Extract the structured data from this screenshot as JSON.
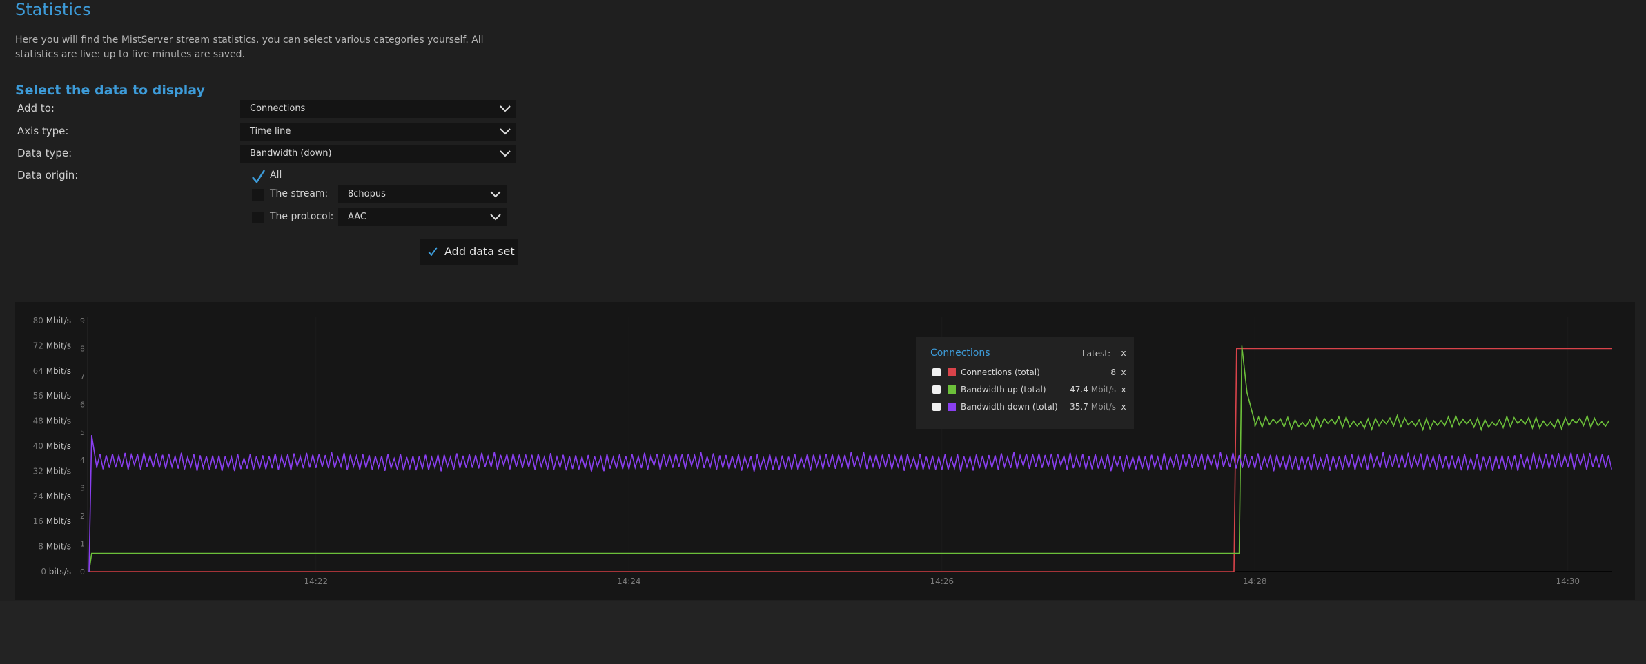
{
  "page": {
    "title": "Statistics",
    "description": "Here you will find the MistServer stream statistics, you can select various categories yourself. All statistics are live: up to five minutes are saved."
  },
  "form": {
    "section_title": "Select the data to display",
    "add_to": {
      "label": "Add to:",
      "value": "Connections"
    },
    "axis_type": {
      "label": "Axis type:",
      "value": "Time line"
    },
    "data_type": {
      "label": "Data type:",
      "value": "Bandwidth (down)"
    },
    "data_origin": {
      "label": "Data origin:",
      "all": {
        "label": "All",
        "checked": true
      },
      "stream": {
        "label": "The stream:",
        "checked": false,
        "value": "8chopus"
      },
      "protocol": {
        "label": "The protocol:",
        "checked": false,
        "value": "AAC"
      }
    },
    "add_button": "Add data set"
  },
  "legend": {
    "title": "Connections",
    "latest_label": "Latest:",
    "close": "x",
    "rows": [
      {
        "name": "Connections (total)",
        "value": "8",
        "unit": "",
        "color": "#d9434a",
        "checked": true,
        "remove": "x"
      },
      {
        "name": "Bandwidth up (total)",
        "value": "47.4",
        "unit": "Mbit/s",
        "color": "#6cc03a",
        "checked": true,
        "remove": "x"
      },
      {
        "name": "Bandwidth down (total)",
        "value": "35.7",
        "unit": "Mbit/s",
        "color": "#8a3ff0",
        "checked": true,
        "remove": "x"
      }
    ]
  },
  "colors": {
    "accent": "#3d9bd8",
    "connections": "#d9434a",
    "bandwidth_up": "#6cc03a",
    "bandwidth_down": "#8a3ff0"
  },
  "chart_data": {
    "type": "line",
    "x_ticks": [
      "14:22",
      "14:24",
      "14:26",
      "14:28",
      "14:30"
    ],
    "x_range": [
      "14:20:33",
      "14:30:17"
    ],
    "y_left": {
      "ticks": [
        {
          "num": "0",
          "unit": "bits/s"
        },
        {
          "num": "8",
          "unit": "Mbit/s"
        },
        {
          "num": "16",
          "unit": "Mbit/s"
        },
        {
          "num": "24",
          "unit": "Mbit/s"
        },
        {
          "num": "32",
          "unit": "Mbit/s"
        },
        {
          "num": "40",
          "unit": "Mbit/s"
        },
        {
          "num": "48",
          "unit": "Mbit/s"
        },
        {
          "num": "56",
          "unit": "Mbit/s"
        },
        {
          "num": "64",
          "unit": "Mbit/s"
        },
        {
          "num": "72",
          "unit": "Mbit/s"
        },
        {
          "num": "80",
          "unit": "Mbit/s"
        }
      ],
      "range": [
        0,
        80
      ]
    },
    "y_right": {
      "ticks": [
        "0",
        "1",
        "2",
        "3",
        "4",
        "5",
        "6",
        "7",
        "8",
        "9"
      ],
      "range": [
        0,
        9
      ]
    },
    "series": [
      {
        "name": "Connections (total)",
        "axis": "right",
        "points": [
          [
            "14:20:33",
            0
          ],
          [
            "14:27:52",
            0
          ],
          [
            "14:27:53",
            8
          ],
          [
            "14:30:17",
            8
          ]
        ]
      },
      {
        "name": "Bandwidth up (total)",
        "axis": "left",
        "points": [
          [
            "14:20:33",
            0
          ],
          [
            "14:20:34",
            5.8
          ],
          [
            "14:27:54",
            5.8
          ],
          [
            "14:27:55",
            72
          ],
          [
            "14:27:57",
            57
          ],
          [
            "14:28:00",
            47.5
          ],
          [
            "14:30:17",
            47.4
          ]
        ],
        "oscillation_after": "14:28:00",
        "oscillation_amplitude": 1.5
      },
      {
        "name": "Bandwidth down (total)",
        "axis": "left",
        "points": [
          [
            "14:20:33",
            0
          ],
          [
            "14:20:34",
            43.5
          ],
          [
            "14:20:36",
            33
          ],
          [
            "14:30:17",
            35.7
          ]
        ],
        "mean": 35,
        "oscillation_amplitude": 2.4
      }
    ]
  }
}
